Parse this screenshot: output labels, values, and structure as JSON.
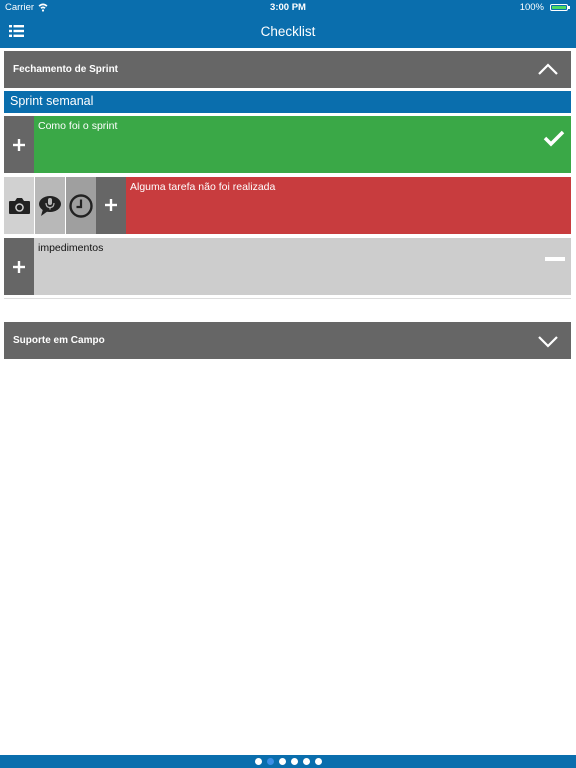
{
  "status_bar": {
    "carrier": "Carrier",
    "time": "3:00 PM",
    "battery": "100%"
  },
  "nav": {
    "title": "Checklist",
    "menu_icon": "list-menu-icon"
  },
  "sections": [
    {
      "label": "Fechamento de Sprint",
      "state": "expanded"
    },
    {
      "label": "Suporte em Campo",
      "state": "collapsed"
    }
  ],
  "group": {
    "label": "Sprint semanal"
  },
  "items": [
    {
      "label": "Como foi o sprint",
      "status": "ok",
      "color": "#3aa847"
    },
    {
      "label": "Alguma tarefa não foi realizada",
      "status": "nok",
      "color": "#c83c3e",
      "actions": [
        "camera-icon",
        "microphone-icon",
        "clock-icon",
        "plus-icon"
      ]
    },
    {
      "label": "impedimentos",
      "status": "na",
      "color": "#cdcdcd"
    }
  ],
  "pager": {
    "count": 6,
    "active": 1
  }
}
